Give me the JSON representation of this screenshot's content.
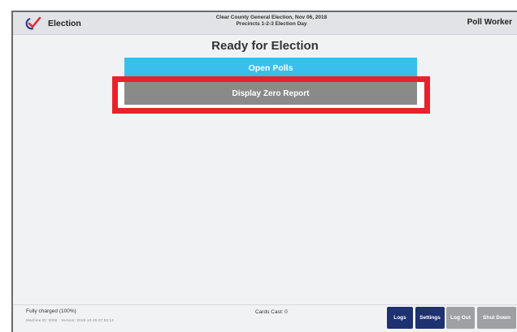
{
  "header": {
    "app_label": "Election",
    "election_title": "Clear County General Election, Nov 06, 2018",
    "precinct_line": "Precincts 1-2-3 Election Day",
    "role": "Poll Worker",
    "icon": "checkmark-ballot-icon"
  },
  "main": {
    "title": "Ready for Election",
    "open_polls_label": "Open Polls",
    "zero_report_label": "Display Zero Report"
  },
  "footer": {
    "battery": "Fully charged (100%)",
    "machine_info": "Machine ID: 0000 · Version: 2018-10-26 07:53:12",
    "cards_cast": "Cards Cast: 0",
    "logs_label": "Logs",
    "settings_label": "Settings",
    "logout_label": "Log Out",
    "shutdown_label": "Shut Down"
  },
  "colors": {
    "primary_button": "#39bfee",
    "secondary_button": "#8a8a8a",
    "highlight": "#e8222b",
    "nav_button": "#1e3170",
    "disabled_button": "#9ea0a4"
  }
}
